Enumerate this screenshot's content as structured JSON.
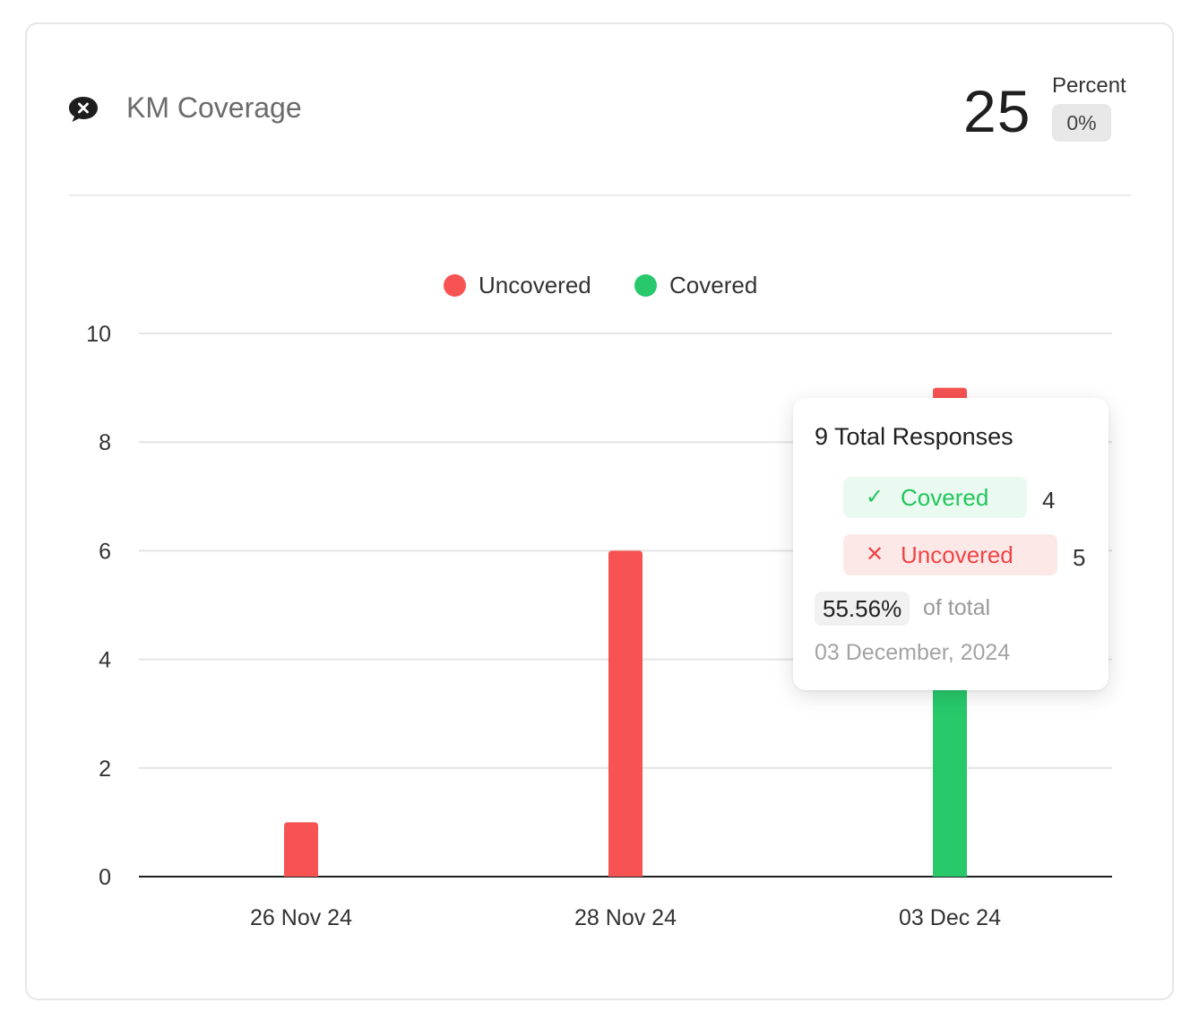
{
  "card": {
    "title": "KM Coverage",
    "title_icon": "chat-close-icon",
    "total": "25",
    "percent_label": "Percent",
    "percent_value": "0%"
  },
  "legend": {
    "items": [
      {
        "label": "Uncovered",
        "color": "#f75353"
      },
      {
        "label": "Covered",
        "color": "#27c96b"
      }
    ]
  },
  "tooltip": {
    "title": "9 Total Responses",
    "covered_label": "Covered",
    "covered_icon": "check-icon",
    "covered_count": "4",
    "uncovered_label": "Uncovered",
    "uncovered_icon": "x-icon",
    "uncovered_count": "5",
    "percent": "55.56%",
    "of_total": "of total",
    "date": "03 December, 2024"
  },
  "chart_data": {
    "type": "bar",
    "stacked": true,
    "categories": [
      "26 Nov 24",
      "28 Nov 24",
      "03 Dec 24"
    ],
    "series": [
      {
        "name": "Covered",
        "color": "#27c96b",
        "values": [
          0,
          0,
          4
        ]
      },
      {
        "name": "Uncovered",
        "color": "#f75353",
        "values": [
          1,
          6,
          5
        ]
      }
    ],
    "ylim": [
      0,
      10
    ],
    "yticks": [
      "0",
      "2",
      "4",
      "6",
      "8",
      "10"
    ],
    "grid": true,
    "legend_position": "top-center"
  }
}
